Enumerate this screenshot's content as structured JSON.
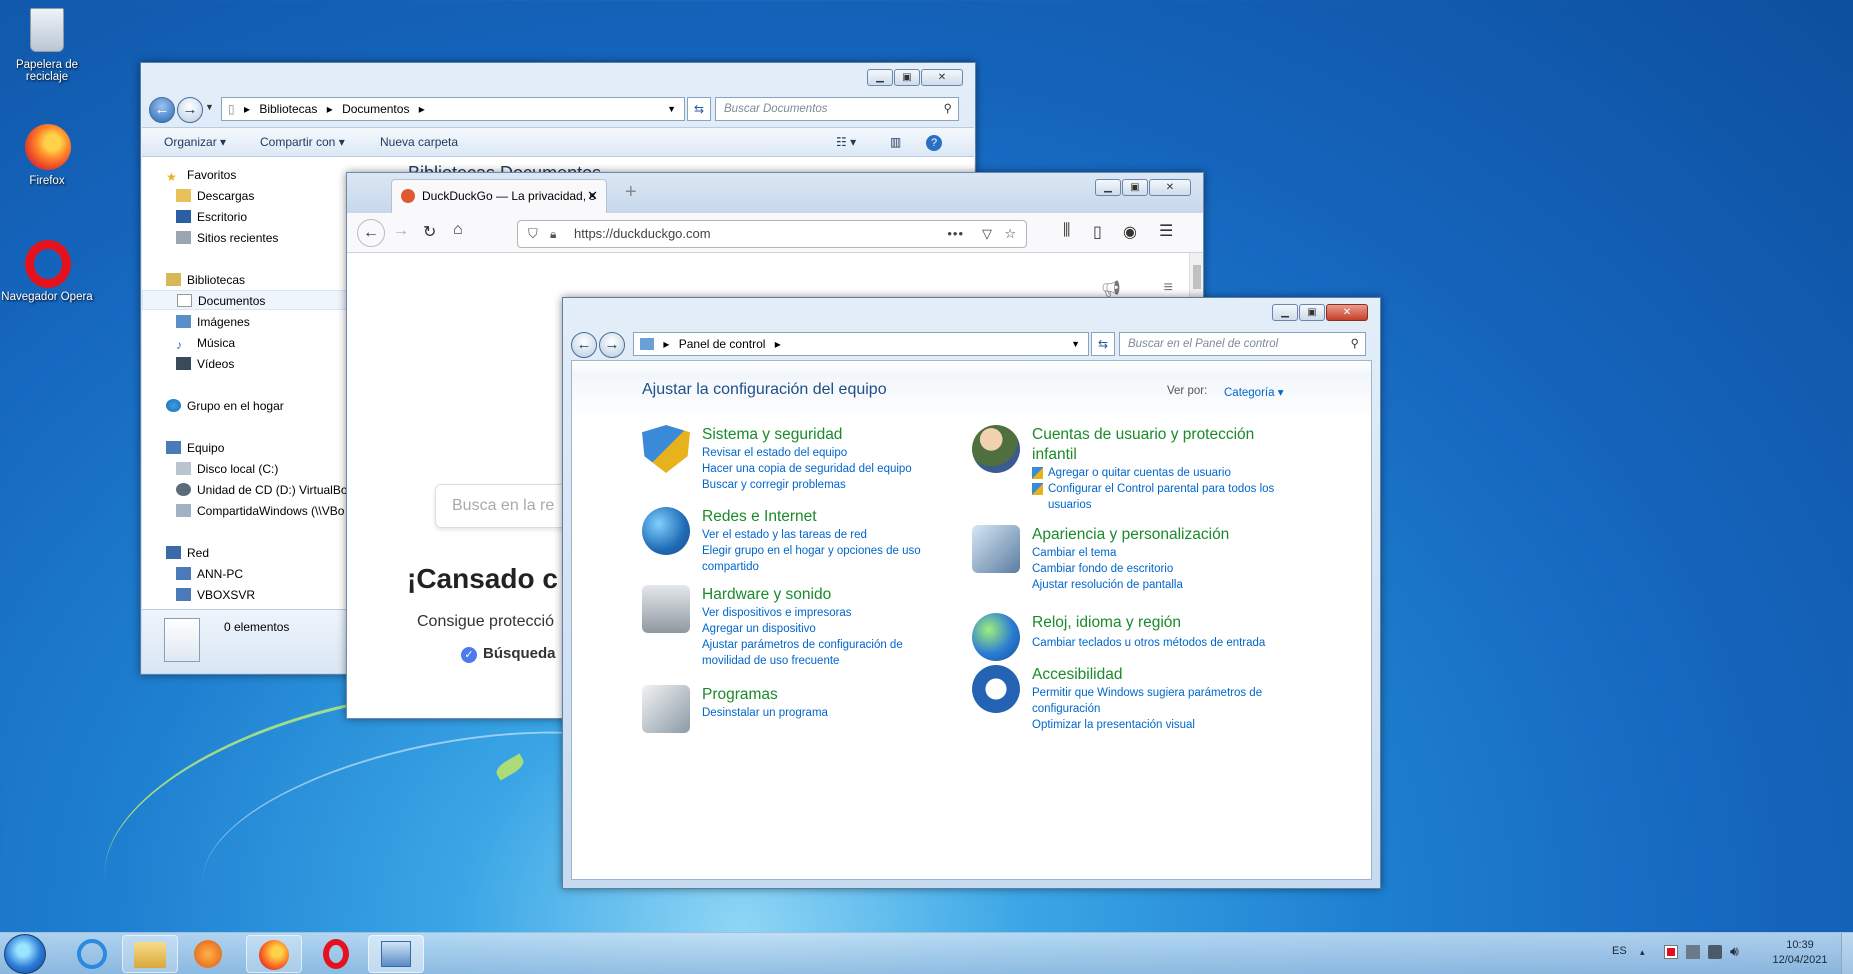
{
  "desktop": {
    "icons": [
      {
        "label": "Papelera de reciclaje",
        "icon": "recycle-bin-icon"
      },
      {
        "label": "Firefox",
        "icon": "firefox-icon"
      },
      {
        "label": "Navegador Opera",
        "icon": "opera-icon"
      }
    ]
  },
  "explorer": {
    "breadcrumb": [
      "Bibliotecas",
      "Documentos"
    ],
    "search_placeholder": "Buscar Documentos",
    "toolbar": {
      "organize": "Organizar",
      "share": "Compartir con",
      "new_folder": "Nueva carpeta"
    },
    "content_title": "Bibliotecas Documentos",
    "nav": {
      "favorites": "Favoritos",
      "favorites_items": [
        "Descargas",
        "Escritorio",
        "Sitios recientes"
      ],
      "libraries": "Bibliotecas",
      "libraries_items": [
        "Documentos",
        "Imágenes",
        "Música",
        "Vídeos"
      ],
      "homegroup": "Grupo en el hogar",
      "computer": "Equipo",
      "computer_items": [
        "Disco local (C:)",
        "Unidad de CD (D:) VirtualBox",
        "CompartidaWindows (\\\\VBo"
      ],
      "network": "Red",
      "network_items": [
        "ANN-PC",
        "VBOXSVR"
      ]
    },
    "status_text": "0 elementos"
  },
  "firefox": {
    "tab_title": "DuckDuckGo — La privacidad, s",
    "url": "https://duckduckgo.com",
    "search_placeholder": "Busca en la re",
    "headline": "¡Cansado c",
    "subline": "Consigue protecció",
    "check_label": "Búsqueda"
  },
  "control_panel": {
    "breadcrumb": "Panel de control",
    "search_placeholder": "Buscar en el Panel de control",
    "title": "Ajustar la configuración del equipo",
    "view_by_label": "Ver por:",
    "view_by_value": "Categoría",
    "left_categories": [
      {
        "title": "Sistema y seguridad",
        "icon": "shield-icon",
        "links": [
          "Revisar el estado del equipo",
          "Hacer una copia de seguridad del equipo",
          "Buscar y corregir problemas"
        ]
      },
      {
        "title": "Redes e Internet",
        "icon": "network-icon",
        "links": [
          "Ver el estado y las tareas de red",
          "Elegir grupo en el hogar y opciones de uso compartido"
        ]
      },
      {
        "title": "Hardware y sonido",
        "icon": "printer-icon",
        "links": [
          "Ver dispositivos e impresoras",
          "Agregar un dispositivo",
          "Ajustar parámetros de configuración de movilidad de uso frecuente"
        ]
      },
      {
        "title": "Programas",
        "icon": "programs-icon",
        "links": [
          "Desinstalar un programa"
        ]
      }
    ],
    "right_categories": [
      {
        "title": "Cuentas de usuario y protección infantil",
        "icon": "users-icon",
        "links": [
          "Agregar o quitar cuentas de usuario",
          "Configurar el Control parental para todos los usuarios"
        ]
      },
      {
        "title": "Apariencia y personalización",
        "icon": "appearance-icon",
        "links": [
          "Cambiar el tema",
          "Cambiar fondo de escritorio",
          "Ajustar resolución de pantalla"
        ]
      },
      {
        "title": "Reloj, idioma y región",
        "icon": "clock-globe-icon",
        "links": [
          "Cambiar teclados u otros métodos de entrada"
        ]
      },
      {
        "title": "Accesibilidad",
        "icon": "accessibility-icon",
        "links": [
          "Permitir que Windows sugiera parámetros de configuración",
          "Optimizar la presentación visual"
        ]
      }
    ]
  },
  "taskbar": {
    "language": "ES",
    "time": "10:39",
    "date": "12/04/2021"
  }
}
